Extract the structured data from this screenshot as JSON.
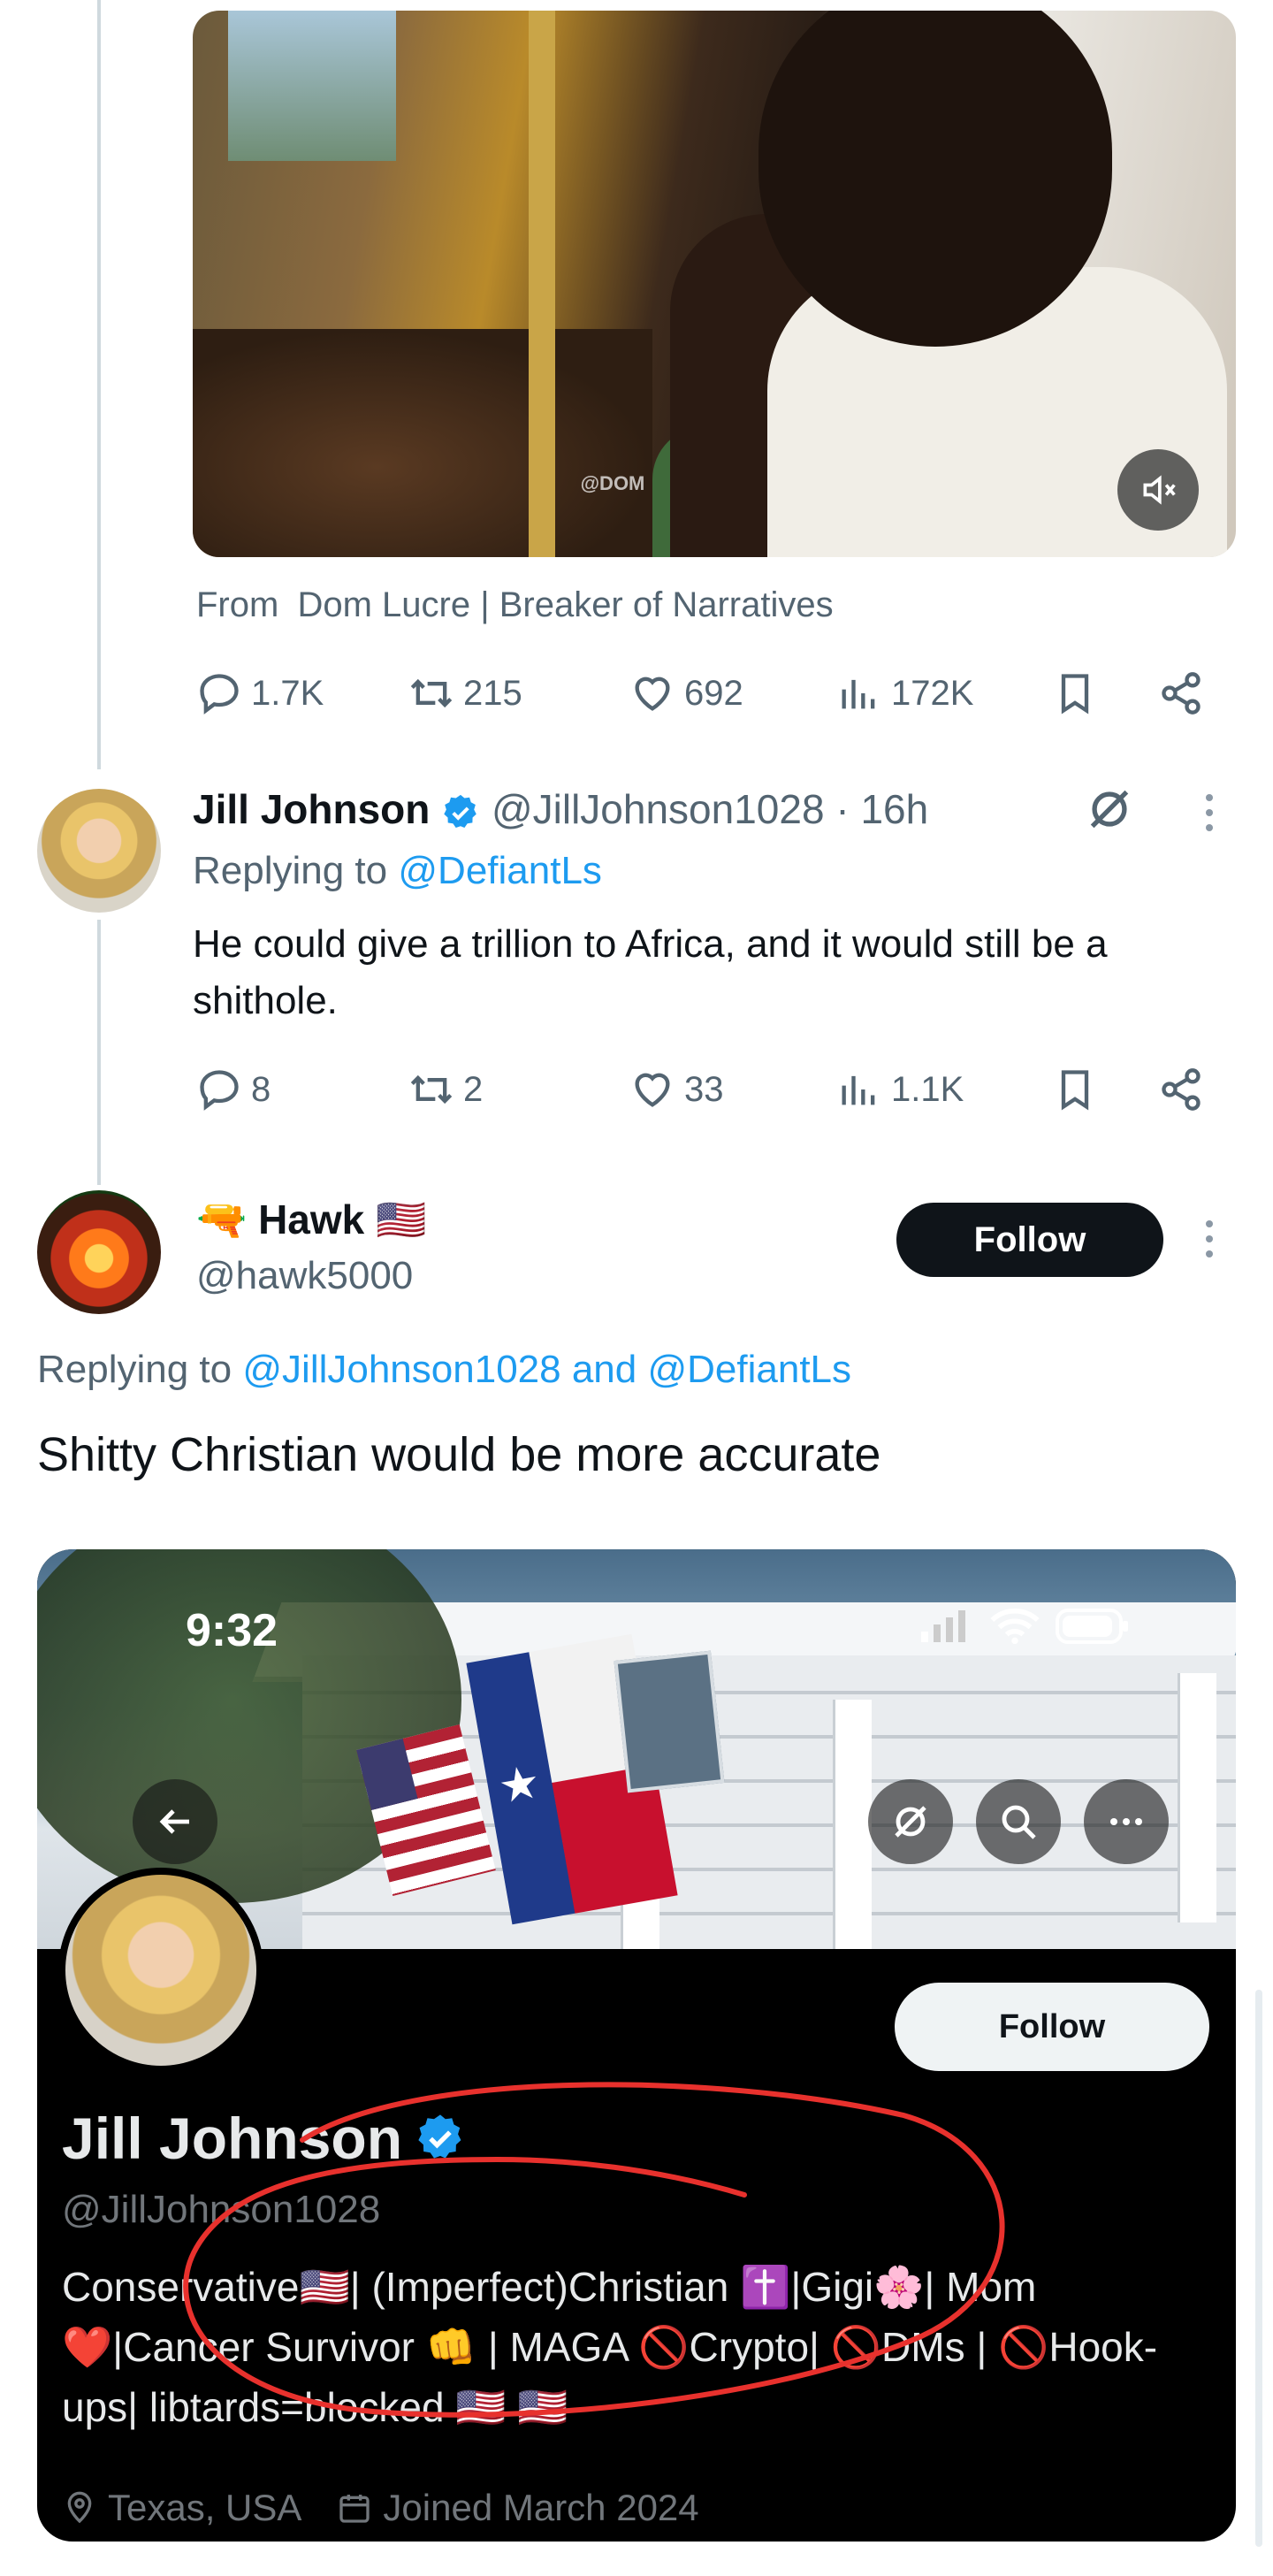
{
  "video": {
    "watermark": "@DOM LUCRE",
    "source_prefix": "From",
    "source_name": "Dom Lucre | Breaker of Narratives",
    "stats": {
      "replies": "1.7K",
      "reposts": "215",
      "likes": "692",
      "views": "172K"
    }
  },
  "reply1": {
    "name": "Jill Johnson",
    "handle": "@JillJohnson1028",
    "dot": "·",
    "time": "16h",
    "replying_prefix": "Replying to",
    "replying_to": "@DefiantLs",
    "text": "He could give a trillion to Africa, and it would still be a shithole.",
    "stats": {
      "replies": "8",
      "reposts": "2",
      "likes": "33",
      "views": "1.1K"
    }
  },
  "reply2": {
    "name": "Hawk",
    "name_emoji_left": "🔫",
    "name_emoji_right": "🇺🇸",
    "handle": "@hawk5000",
    "follow_label": "Follow",
    "replying_prefix": "Replying to",
    "replying_to": "@JillJohnson1028 and @DefiantLs",
    "text": "Shitty Christian would be more accurate"
  },
  "embed_profile": {
    "status_time": "9:32",
    "follow_label": "Follow",
    "name": "Jill Johnson",
    "handle": "@JillJohnson1028",
    "bio": "Conservative🇺🇸| (Imperfect)Christian ✝️|Gigi🌸| Mom ❤️|Cancer Survivor 👊 | MAGA 🚫Crypto| 🚫DMs | 🚫Hook-ups| libtards=blocked 🇺🇸 🇺🇸",
    "location": "Texas, USA",
    "joined": "Joined March 2024"
  },
  "colors": {
    "accent": "#1d9bf0",
    "text_primary": "#0f1419",
    "text_secondary": "#536471",
    "annotation_red": "#e8312d"
  },
  "icons": [
    "reply-icon",
    "repost-icon",
    "like-icon",
    "views-icon",
    "bookmark-icon",
    "share-icon",
    "mute-icon",
    "grok-icon",
    "verified-icon",
    "back-icon",
    "search-icon",
    "more-icon",
    "location-icon",
    "calendar-icon"
  ]
}
